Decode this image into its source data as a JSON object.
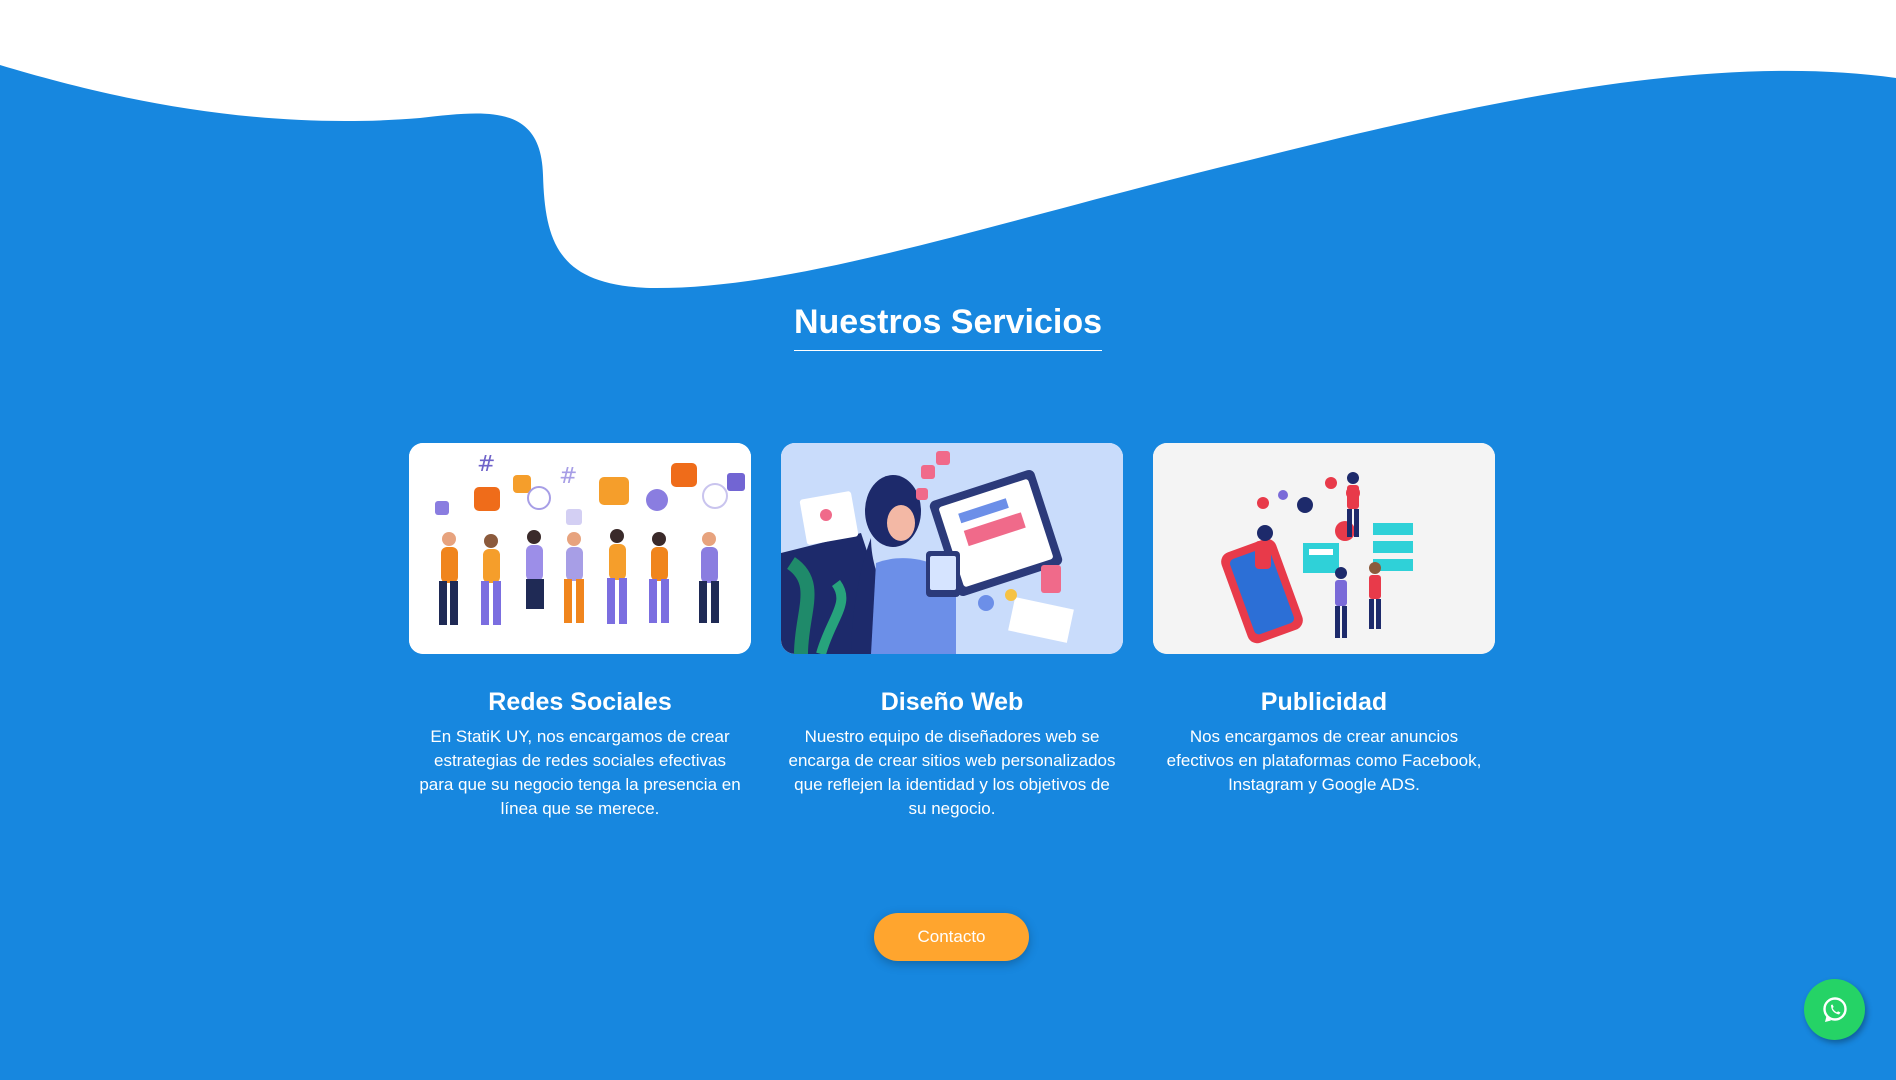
{
  "section": {
    "title": "Nuestros Servicios"
  },
  "services": [
    {
      "title": "Redes Sociales",
      "description": "En StatiK UY, nos encargamos de crear estrategias de redes sociales efectivas para que su negocio tenga la presencia en línea que se merece.",
      "image": "social-media-crowd-illustration"
    },
    {
      "title": "Diseño Web",
      "description": "Nuestro equipo de diseñadores web se encarga de crear sitios web personalizados que reflejen la identidad y los objetivos de su negocio.",
      "image": "web-designer-laptop-illustration"
    },
    {
      "title": "Publicidad",
      "description": "Nos encargamos de crear anuncios efectivos en plataformas como Facebook, Instagram y Google ADS.",
      "image": "digital-advertising-phone-illustration"
    }
  ],
  "cta": {
    "label": "Contacto"
  },
  "floating": {
    "icon": "whatsapp-icon"
  },
  "colors": {
    "background": "#1787df",
    "cta": "#ffa52e",
    "whatsapp": "#25d366"
  }
}
